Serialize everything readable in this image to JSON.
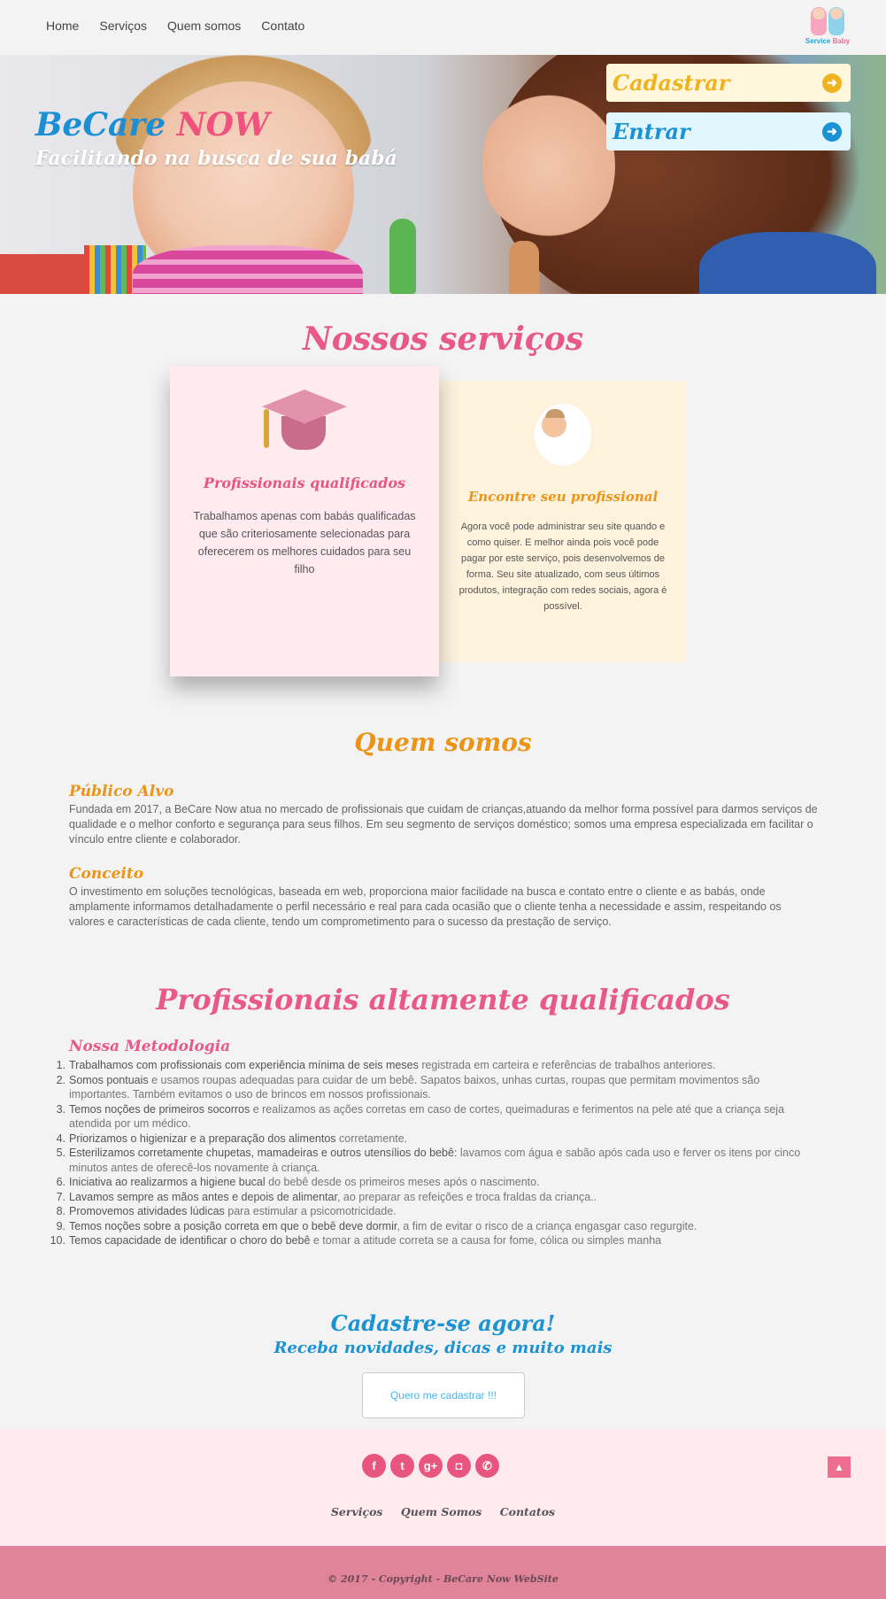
{
  "nav": {
    "links": [
      "Home",
      "Serviços",
      "Quem somos",
      "Contato"
    ],
    "logo_text_1": "Service",
    "logo_text_2": "Baby"
  },
  "hero": {
    "title_1": "BeCare",
    "title_2": "NOW",
    "subtitle": "Facilitando na busca de sua babá",
    "btn_cadastrar": "Cadastrar",
    "btn_entrar": "Entrar",
    "arrow_icon": "arrow-right-circle-icon"
  },
  "services": {
    "title": "Nossos serviços",
    "cards": [
      {
        "title": "Profissionais qualificados",
        "text": "Trabalhamos apenas com babás qualificadas que são criteriosamente selecionadas para oferecerem os melhores cuidados para seu filho"
      },
      {
        "title": "Encontre seu profissional",
        "text": "Agora você pode administrar seu site quando e como quiser. E melhor ainda pois você pode pagar por este serviço, pois desenvolvemos de forma. Seu site atualizado, com seus últimos produtos, integração com redes sociais, agora é possível."
      }
    ]
  },
  "about": {
    "title": "Quem somos",
    "publico_title": "Público Alvo",
    "publico_text": "Fundada em 2017, a BeCare Now atua no mercado de profissionais que cuidam de crianças,atuando da melhor forma possível para darmos serviços de qualidade e o melhor conforto e segurança para seus filhos. Em seu segmento de serviços doméstico; somos uma empresa especializada em facilitar o vínculo entre cliente e colaborador.",
    "conceito_title": "Conceito",
    "conceito_text": "O investimento em soluções tecnológicas, baseada em web, proporciona maior facilidade na busca e contato entre o cliente e as babás, onde amplamente informamos detalhadamente o perfil necessário e real para cada ocasião que o cliente tenha a necessidade e assim, respeitando os valores e características de cada cliente, tendo um comprometimento para o sucesso da prestação de serviço."
  },
  "prof": {
    "title": "Profissionais altamente qualificados",
    "subtitle": "Nossa Metodologia",
    "items": [
      {
        "n": "1.",
        "b": "Trabalhamos com profissionais com experiência mínima de seis meses",
        "t": " registrada em carteira e referências de trabalhos anteriores."
      },
      {
        "n": "2.",
        "b": "Somos pontuais",
        "t": " e usamos roupas adequadas para cuidar de um bebê. Sapatos baixos, unhas curtas, roupas que permitam movimentos são importantes. Também evitamos o uso de brincos em nossos profissionais."
      },
      {
        "n": "3.",
        "b": "Temos noções de primeiros socorros",
        "t": " e realizamos as ações corretas em caso de cortes, queimaduras e ferimentos na pele até que a criança seja atendida por um médico."
      },
      {
        "n": "4.",
        "b": "Priorizamos o higienizar e a preparação dos alimentos",
        "t": " corretamente."
      },
      {
        "n": "5.",
        "b": "Esterilizamos corretamente chupetas, mamadeiras e outros utensílios do bebê:",
        "t": " lavamos com água e sabão após cada uso e ferver os itens por cinco minutos antes de oferecê-los novamente à criança."
      },
      {
        "n": "6.",
        "b": "Iniciativa ao realizarmos a higiene bucal",
        "t": " do bebê desde os primeiros meses após o nascimento."
      },
      {
        "n": "7.",
        "b": "Lavamos sempre as mãos antes e depois de alimentar",
        "t": ", ao preparar as refeições e troca fraldas da criança.."
      },
      {
        "n": "8.",
        "b": "Promovemos atividades lúdicas",
        "t": " para estimular a psicomotricidade."
      },
      {
        "n": "9.",
        "b": "Temos noções sobre a posição correta em que o bebê deve dormir",
        "t": ", a fim de evitar o risco de a criança engasgar caso regurgite."
      },
      {
        "n": "10.",
        "b": "Temos capacidade de identificar o choro do bebê",
        "t": " e tomar a atitude correta se a causa for fome, cólica ou simples manha"
      }
    ]
  },
  "cta": {
    "title": "Cadastre-se agora!",
    "subtitle": "Receba novidades, dicas e muito mais",
    "button": "Quero me cadastrar !!!"
  },
  "footer": {
    "socials": [
      {
        "icon": "facebook-icon",
        "glyph": "f"
      },
      {
        "icon": "twitter-icon",
        "glyph": "t"
      },
      {
        "icon": "google-plus-icon",
        "glyph": "g+"
      },
      {
        "icon": "instagram-icon",
        "glyph": "◘"
      },
      {
        "icon": "whatsapp-icon",
        "glyph": "✆"
      }
    ],
    "links": [
      "Serviços",
      "Quem Somos",
      "Contatos"
    ],
    "copyright": "© 2017 - Copyright - BeCare Now WebSite",
    "to_top_icon": "chevron-up-icon"
  },
  "colors": {
    "pink": "#e9588a",
    "blue": "#1b92d3",
    "orange": "#eb9418",
    "yellow": "#f0b320",
    "card_pink": "#ffeaf0",
    "card_cream": "#fdf2dc",
    "footer_bar": "#df8499"
  }
}
